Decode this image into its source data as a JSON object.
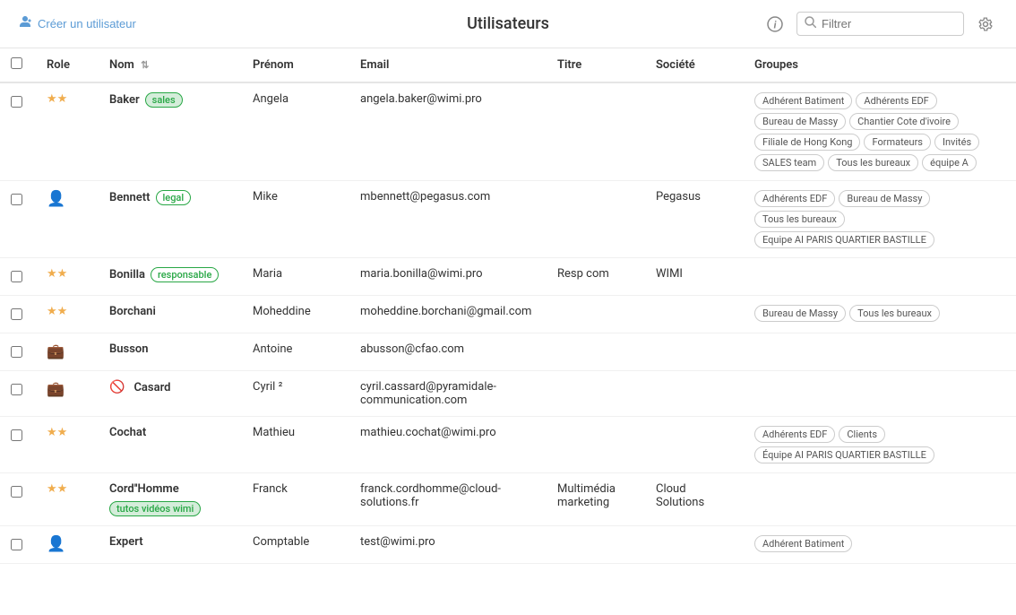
{
  "header": {
    "create_user_label": "Créer un utilisateur",
    "title": "Utilisateurs",
    "search_placeholder": "Filtrer"
  },
  "columns": {
    "role": "Role",
    "nom": "Nom",
    "prenom": "Prénom",
    "email": "Email",
    "titre": "Titre",
    "societe": "Société",
    "groupes": "Groupes"
  },
  "users": [
    {
      "id": 1,
      "role_type": "stars",
      "nom": "Baker",
      "badge": "sales",
      "badge_type": "sales",
      "prenom": "Angela",
      "email": "angela.baker@wimi.pro",
      "titre": "",
      "societe": "",
      "groups": [
        "Adhérent Batiment",
        "Adhérents EDF",
        "Bureau de Massy",
        "Chantier Cote d'ivoire",
        "Filiale de Hong Kong",
        "Formateurs",
        "Invités",
        "SALES team",
        "Tous les bureaux",
        "équipe A"
      ],
      "groups_dark": []
    },
    {
      "id": 2,
      "role_type": "person",
      "nom": "Bennett",
      "badge": "legal",
      "badge_type": "legal",
      "prenom": "Mike",
      "email": "mbennett@pegasus.com",
      "titre": "",
      "societe": "Pegasus",
      "groups": [
        "Adhérents EDF",
        "Bureau de Massy",
        "Tous les bureaux",
        "Equipe AI PARIS QUARTIER BASTILLE"
      ],
      "groups_dark": []
    },
    {
      "id": 3,
      "role_type": "stars",
      "nom": "Bonilla",
      "badge": "responsable",
      "badge_type": "responsable",
      "prenom": "Maria",
      "email": "maria.bonilla@wimi.pro",
      "titre": "Resp com",
      "societe": "WIMI",
      "groups": [],
      "groups_dark": []
    },
    {
      "id": 4,
      "role_type": "stars",
      "nom": "Borchani",
      "badge": "",
      "badge_type": "",
      "prenom": "Moheddine",
      "email": "moheddine.borchani@gmail.com",
      "titre": "",
      "societe": "",
      "groups": [
        "Bureau de Massy",
        "Tous les bureaux"
      ],
      "groups_dark": []
    },
    {
      "id": 5,
      "role_type": "briefcase",
      "nom": "Busson",
      "badge": "",
      "badge_type": "",
      "prenom": "Antoine",
      "email": "abusson@cfao.com",
      "titre": "",
      "societe": "",
      "groups": [],
      "groups_dark": []
    },
    {
      "id": 6,
      "role_type": "briefcase",
      "nom": "Casard",
      "badge": "",
      "badge_type": "",
      "banned": true,
      "prenom": "Cyril ²",
      "email": "cyril.cassard@pyramidale-communication.com",
      "titre": "",
      "societe": "",
      "groups": [],
      "groups_dark": []
    },
    {
      "id": 7,
      "role_type": "stars",
      "nom": "Cochat",
      "badge": "",
      "badge_type": "",
      "prenom": "Mathieu",
      "email": "mathieu.cochat@wimi.pro",
      "titre": "",
      "societe": "",
      "groups": [
        "Adhérents EDF",
        "Clients",
        "Équipe AI PARIS QUARTIER BASTILLE"
      ],
      "groups_dark": []
    },
    {
      "id": 8,
      "role_type": "stars",
      "nom": "Cord''Homme",
      "badge": "tutos vidéos wimi",
      "badge_type": "tutos",
      "prenom": "Franck",
      "email": "franck.cordhomme@cloud-solutions.fr",
      "titre": "Multimédia marketing",
      "societe": "Cloud Solutions",
      "groups": [],
      "groups_dark": []
    },
    {
      "id": 9,
      "role_type": "person",
      "nom": "Expert",
      "badge": "",
      "badge_type": "",
      "prenom": "Comptable",
      "email": "test@wimi.pro",
      "titre": "",
      "societe": "",
      "groups": [
        "Adhérent Batiment"
      ],
      "groups_dark": []
    }
  ]
}
